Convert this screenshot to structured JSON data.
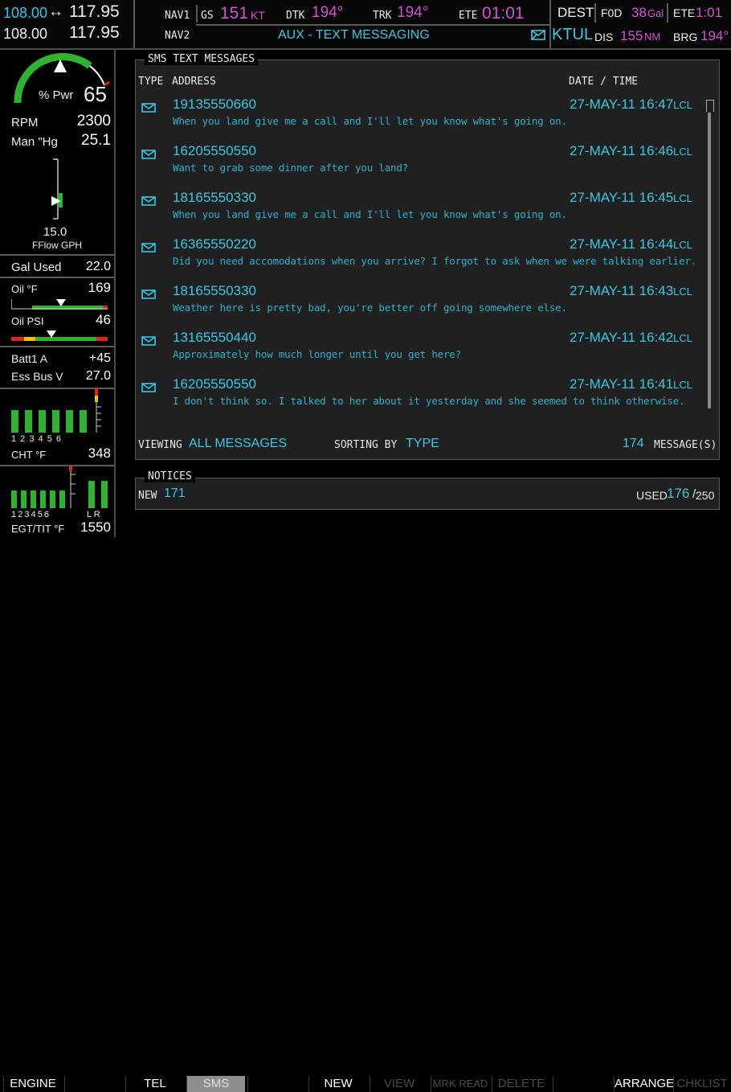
{
  "topbar": {
    "com1_active": "108.00",
    "com1_swap": "↔",
    "com1_standby": "117.95",
    "com2_active": "108.00",
    "com2_standby": "117.95",
    "nav1_label": "NAV1",
    "nav2_label": "NAV2",
    "gs_label": "GS",
    "gs_value": "151",
    "gs_unit": "KT",
    "dtk_label": "DTK",
    "dtk_value": "194°",
    "trk_label": "TRK",
    "trk_value": "194°",
    "ete_label": "ETE",
    "ete_value": "01:01",
    "page_title": "AUX - TEXT MESSAGING",
    "dest_label": "DEST",
    "dest_value": "F0D",
    "fuel_value": "38",
    "fuel_unit": "Gal",
    "ete2_label": "ETE",
    "ete2_value": "1:01",
    "waypoint": "KTUL",
    "dis_label": "DIS",
    "dis_value": "155",
    "dis_unit": "NM",
    "brg_label": "BRG",
    "brg_value": "194°"
  },
  "engine": {
    "pwr_label": "% Pwr",
    "pwr_value": "65",
    "rpm_label": "RPM",
    "rpm_value": "2300",
    "man_label": "Man \"Hg",
    "man_value": "25.1",
    "fflow_value": "15.0",
    "fflow_label": "FFlow GPH",
    "gal_used_label": "Gal Used",
    "gal_used_value": "22.0",
    "oil_f_label": "Oil °F",
    "oil_f_value": "169",
    "oil_psi_label": "Oil PSI",
    "oil_psi_value": "46",
    "batt_label": "Batt1 A",
    "batt_value": "+45",
    "essbus_label": "Ess Bus V",
    "essbus_value": "27.0",
    "cht_cyls": "1 2 3 4 5 6",
    "cht_label": "CHT °F",
    "cht_value": "348",
    "egt_cyls": "1 2 3 4 5 6",
    "egt_lr": "L R",
    "egt_label": "EGT/TIT °F",
    "egt_value": "1550"
  },
  "sms": {
    "title": "SMS TEXT MESSAGES",
    "col_type": "TYPE",
    "col_address": "ADDRESS",
    "col_datetime": "DATE / TIME",
    "messages": [
      {
        "address": "19135550660",
        "date": "27-MAY-11 16:47",
        "tz": "LCL",
        "text": "When you land give me a call and I'll let you know what's going on."
      },
      {
        "address": "16205550550",
        "date": "27-MAY-11 16:46",
        "tz": "LCL",
        "text": "Want to grab some dinner after you land?"
      },
      {
        "address": "18165550330",
        "date": "27-MAY-11 16:45",
        "tz": "LCL",
        "text": "When you land give me a call and I'll let you know what's going on."
      },
      {
        "address": "16365550220",
        "date": "27-MAY-11 16:44",
        "tz": "LCL",
        "text": "Did you need accomodations when you arrive? I forgot to ask when we were talking earlier."
      },
      {
        "address": "18165550330",
        "date": "27-MAY-11 16:43",
        "tz": "LCL",
        "text": "Weather here is pretty bad, you're better off going somewhere else."
      },
      {
        "address": "13165550440",
        "date": "27-MAY-11 16:42",
        "tz": "LCL",
        "text": "Approximately how much longer until you get here?"
      },
      {
        "address": "16205550550",
        "date": "27-MAY-11 16:41",
        "tz": "LCL",
        "text": "I don't think so. I talked to her about it yesterday and she seemed to think otherwise."
      }
    ],
    "viewing_label": "VIEWING",
    "viewing_value": "ALL MESSAGES",
    "sorting_label": "SORTING BY",
    "sorting_value": "TYPE",
    "count_value": "174",
    "count_label": "MESSAGE(S)"
  },
  "notices": {
    "title": "NOTICES",
    "new_label": "NEW",
    "new_value": "171",
    "used_label": "USED",
    "used_value": "176",
    "used_sep": "/",
    "used_total": "250"
  },
  "softkeys": [
    {
      "label": "ENGINE",
      "state": "active"
    },
    {
      "label": "",
      "state": "blank"
    },
    {
      "label": "TEL",
      "state": "active"
    },
    {
      "label": "SMS",
      "state": "selected"
    },
    {
      "label": "",
      "state": "blank"
    },
    {
      "label": "NEW",
      "state": "active"
    },
    {
      "label": "VIEW",
      "state": "disabled"
    },
    {
      "label": "MRK READ",
      "state": "disabled"
    },
    {
      "label": "DELETE",
      "state": "disabled"
    },
    {
      "label": "",
      "state": "blank"
    },
    {
      "label": "ARRANGE",
      "state": "active"
    },
    {
      "label": "CHKLIST",
      "state": "disabled"
    }
  ],
  "colors": {
    "cyan": "#37c8e6",
    "magenta": "#d64fd6",
    "gauge_green": "#2fb32f",
    "panel_bg": "#202020"
  }
}
